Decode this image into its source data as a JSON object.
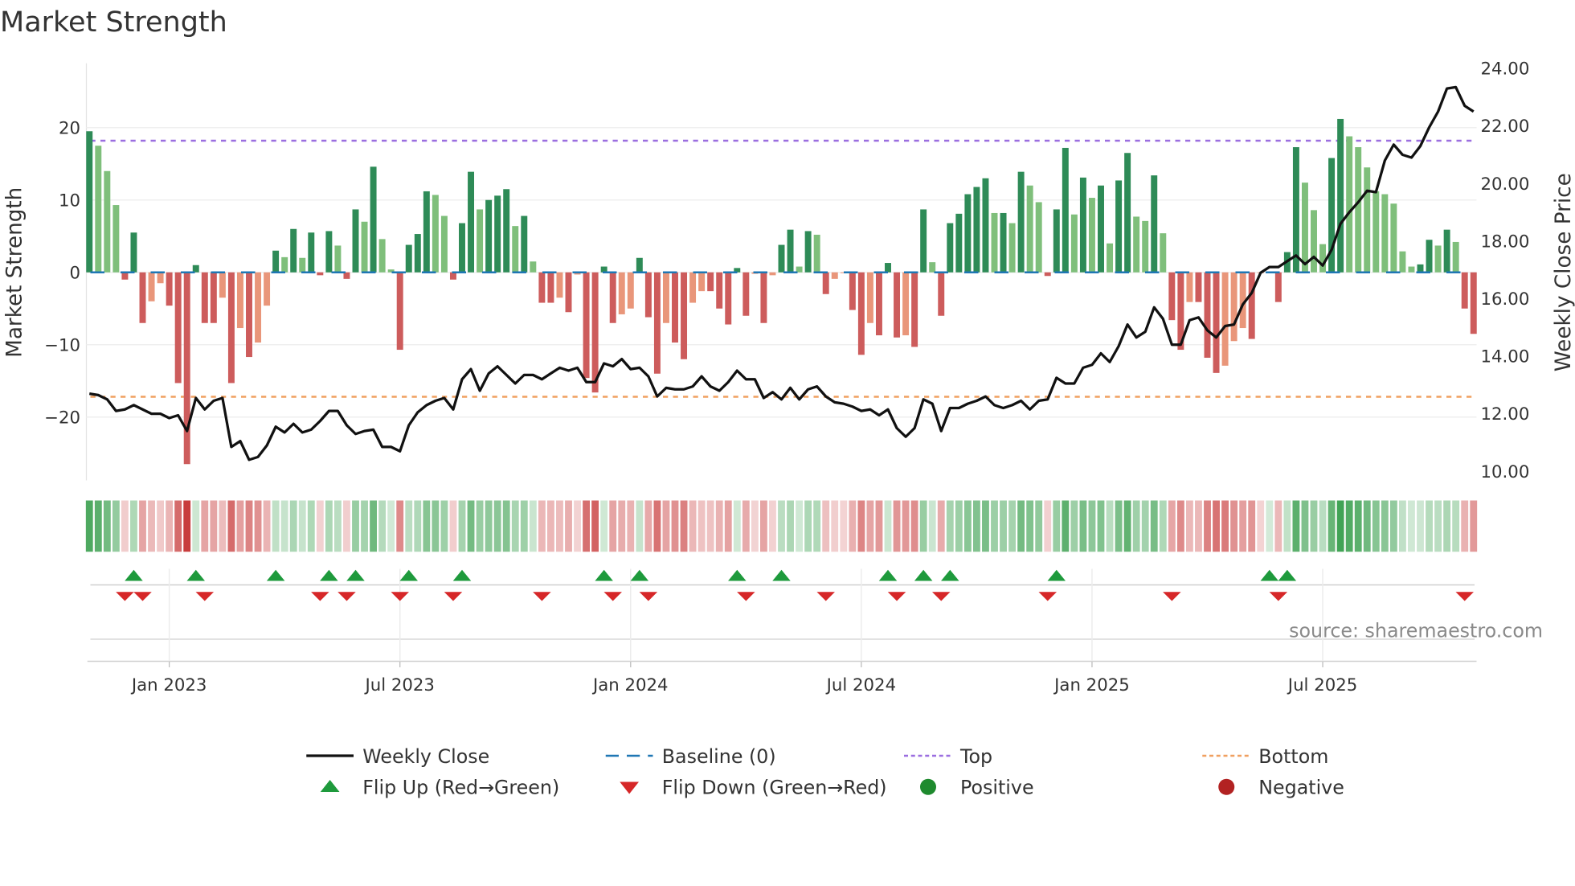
{
  "chart_data": {
    "type": "bar",
    "title": "Market Strength",
    "ylabel": "Market Strength",
    "ylabel_right": "Weekly Close Price",
    "ylim": [
      -28.8,
      28.6
    ],
    "ylim_right": [
      9.7,
      24.15
    ],
    "yticks": [
      {
        "v": 20,
        "label": "20"
      },
      {
        "v": 10,
        "label": "10"
      },
      {
        "v": 0,
        "label": "0"
      },
      {
        "v": -10,
        "label": "−10"
      },
      {
        "v": -20,
        "label": "−20"
      }
    ],
    "yticks_right": [
      {
        "v": 24,
        "label": "24.00"
      },
      {
        "v": 22,
        "label": "22.00"
      },
      {
        "v": 20,
        "label": "20.00"
      },
      {
        "v": 18,
        "label": "18.00"
      },
      {
        "v": 16,
        "label": "16.00"
      },
      {
        "v": 14,
        "label": "14.00"
      },
      {
        "v": 12,
        "label": "12.00"
      },
      {
        "v": 10,
        "label": "10.00"
      }
    ],
    "xticks": [
      {
        "week": 9,
        "label": "Jan 2023"
      },
      {
        "week": 35,
        "label": "Jul 2023"
      },
      {
        "week": 61,
        "label": "Jan 2024"
      },
      {
        "week": 87,
        "label": "Jul 2024"
      },
      {
        "week": 113,
        "label": "Jan 2025"
      },
      {
        "week": 139,
        "label": "Jul 2025"
      }
    ],
    "top": 18.2,
    "bottom": -17.2,
    "baseline": 0,
    "strength": [
      19.5,
      17.5,
      14,
      9.3,
      -1,
      5.5,
      -7,
      -4,
      -1.5,
      -4.6,
      -15.3,
      -26.5,
      1,
      -7,
      -7,
      -3.5,
      -15.3,
      -7.7,
      -11.7,
      -9.7,
      -4.6,
      3,
      2.1,
      6,
      2,
      5.5,
      -0.4,
      5.7,
      3.7,
      -0.9,
      8.7,
      7,
      14.6,
      4.6,
      0.4,
      -10.7,
      3.8,
      5.3,
      11.2,
      10.7,
      7.8,
      -1,
      6.8,
      13.9,
      8.7,
      10,
      10.6,
      11.5,
      6.4,
      7.8,
      1.5,
      -4.2,
      -4.2,
      -3.5,
      -5.5,
      -0.3,
      -14.6,
      -16.6,
      0.8,
      -7,
      -5.8,
      -5,
      2,
      -6.2,
      -14,
      -7,
      -9.7,
      -12,
      -4.2,
      -2.6,
      -2.6,
      -5,
      -7.2,
      0.6,
      -6,
      -0.2,
      -7,
      -0.4,
      3.8,
      5.9,
      0.8,
      5.7,
      5.2,
      -3,
      -0.9,
      -0.1,
      -5.2,
      -11.4,
      -7,
      -8.7,
      1.3,
      -9,
      -8.7,
      -10.3,
      8.7,
      1.4,
      -6,
      6.8,
      8.1,
      10.8,
      11.8,
      13,
      8.2,
      8.2,
      6.8,
      13.9,
      12,
      9.7,
      -0.5,
      8.7,
      17.2,
      8,
      13.1,
      10.3,
      12,
      4,
      12.7,
      16.5,
      7.7,
      7.1,
      13.4,
      5.4,
      -6.6,
      -10.7,
      -4.1,
      -4.1,
      -11.8,
      -13.9,
      -12.9,
      -9.5,
      -7.7,
      -9.2,
      -0.1,
      0.1,
      -4.1,
      2.8,
      17.3,
      12.4,
      8.6,
      3.9,
      15.8,
      21.2,
      18.8,
      17.3,
      14.5,
      11.2,
      10.8,
      9.5,
      2.9,
      0.8,
      1.1,
      4.5,
      3.7,
      5.9,
      4.2,
      -5,
      -8.5
    ],
    "weekly_close": [
      12.7,
      12.65,
      12.5,
      12.1,
      12.15,
      12.3,
      12.15,
      12.0,
      12.0,
      11.85,
      11.95,
      11.4,
      12.55,
      12.15,
      12.45,
      12.55,
      10.85,
      11.05,
      10.4,
      10.5,
      10.9,
      11.55,
      11.35,
      11.65,
      11.35,
      11.45,
      11.75,
      12.1,
      12.1,
      11.6,
      11.3,
      11.4,
      11.45,
      10.85,
      10.85,
      10.7,
      11.6,
      12.05,
      12.3,
      12.45,
      12.55,
      12.15,
      13.2,
      13.55,
      12.8,
      13.4,
      13.65,
      13.35,
      13.05,
      13.35,
      13.35,
      13.2,
      13.4,
      13.6,
      13.5,
      13.6,
      13.1,
      13.1,
      13.75,
      13.65,
      13.9,
      13.55,
      13.6,
      13.3,
      12.6,
      12.9,
      12.85,
      12.85,
      12.95,
      13.3,
      12.95,
      12.8,
      13.1,
      13.5,
      13.2,
      13.2,
      12.55,
      12.75,
      12.5,
      12.9,
      12.5,
      12.85,
      12.95,
      12.6,
      12.4,
      12.35,
      12.25,
      12.1,
      12.15,
      11.95,
      12.15,
      11.5,
      11.2,
      11.5,
      12.5,
      12.35,
      11.4,
      12.2,
      12.2,
      12.35,
      12.45,
      12.6,
      12.3,
      12.2,
      12.3,
      12.45,
      12.15,
      12.45,
      12.5,
      13.25,
      13.05,
      13.05,
      13.6,
      13.7,
      14.1,
      13.8,
      14.35,
      15.1,
      14.65,
      14.85,
      15.7,
      15.3,
      14.4,
      14.4,
      15.25,
      15.35,
      14.9,
      14.65,
      15.05,
      15.1,
      15.8,
      16.2,
      16.9,
      17.1,
      17.1,
      17.3,
      17.5,
      17.2,
      17.45,
      17.15,
      17.7,
      18.6,
      19.0,
      19.35,
      19.75,
      19.7,
      20.8,
      21.35,
      21.0,
      20.9,
      21.3,
      21.95,
      22.5,
      23.3,
      23.35,
      22.7,
      22.5
    ],
    "flip_up_weeks": [
      5,
      12,
      21,
      27,
      30,
      36,
      42,
      58,
      62,
      73,
      78,
      90,
      94,
      97,
      109,
      133,
      135
    ],
    "flip_down_weeks": [
      4,
      6,
      13,
      26,
      29,
      35,
      41,
      51,
      59,
      63,
      74,
      83,
      91,
      96,
      108,
      122,
      134,
      155
    ],
    "legend": {
      "placement": "bottom",
      "items": [
        {
          "label": "Weekly Close",
          "kind": "line",
          "color": "#111111"
        },
        {
          "label": "Baseline (0)",
          "kind": "dash",
          "color": "#1f77b4"
        },
        {
          "label": "Top",
          "kind": "dot",
          "color": "#9b6ee0"
        },
        {
          "label": "Bottom",
          "kind": "dot",
          "color": "#f0a060"
        },
        {
          "label": "Flip Up (Red→Green)",
          "kind": "tri-up",
          "color": "#1e9a3c"
        },
        {
          "label": "Flip Down (Green→Red)",
          "kind": "tri-down",
          "color": "#d62728"
        },
        {
          "label": "Positive",
          "kind": "circle",
          "color": "#1e8a2e"
        },
        {
          "label": "Negative",
          "kind": "circle",
          "color": "#b22222"
        }
      ]
    },
    "colors": {
      "pos_up": "#2e8b57",
      "pos_down": "#7fbf7b",
      "neg_down": "#cd5c5c",
      "neg_up": "#e9967a",
      "top": "#9b6ee0",
      "bottom": "#f0a060",
      "baseline": "#1f77b4"
    }
  },
  "source": "source: sharemaestro.com"
}
